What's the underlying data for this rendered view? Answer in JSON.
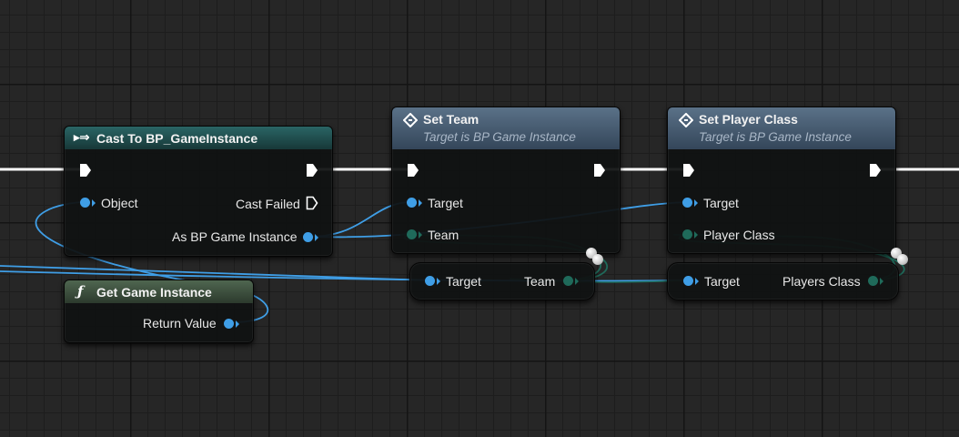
{
  "nodes": {
    "cast": {
      "title": "Cast To BP_GameInstance",
      "pins": {
        "object": "Object",
        "cast_failed": "Cast Failed",
        "as_instance": "As BP Game Instance"
      },
      "header_color": "#1f4b4b"
    },
    "get_game_instance": {
      "title": "Get Game Instance",
      "icon_glyph": "ƒ",
      "pins": {
        "return_value": "Return Value"
      },
      "header_color": "#394a3a"
    },
    "set_team": {
      "title": "Set Team",
      "subtitle": "Target is BP Game Instance",
      "pins": {
        "target": "Target",
        "team": "Team"
      },
      "header_color": "#3c5064"
    },
    "set_player_class": {
      "title": "Set Player Class",
      "subtitle": "Target is BP Game Instance",
      "pins": {
        "target": "Target",
        "player_class": "Player Class"
      },
      "header_color": "#3c5064"
    },
    "get_team": {
      "pins": {
        "target": "Target",
        "team": "Team"
      }
    },
    "get_players_class": {
      "pins": {
        "target": "Target",
        "players_class": "Players Class"
      }
    }
  },
  "colors": {
    "object_pin": "#3f9ee6",
    "struct_pin": "#1f6a5a",
    "exec_wire": "#ffffff"
  }
}
